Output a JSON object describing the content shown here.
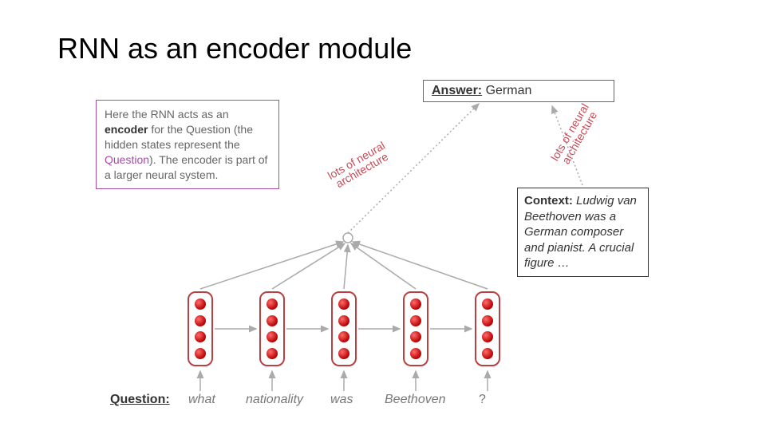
{
  "title": "RNN as an encoder module",
  "description": {
    "line1_prefix": "Here the RNN acts as an ",
    "line1_bold": "encoder",
    "line1_suffix": " for the Question (the hidden states represent the ",
    "line1_purple": "Question",
    "line1_end": "). The encoder is part of a larger neural system."
  },
  "answer": {
    "label": "Answer:",
    "text": "German"
  },
  "context": {
    "label": "Context:",
    "text": "Ludwig van Beethoven was a German composer and pianist. A crucial figure …"
  },
  "question": {
    "label": "Question:",
    "tokens": [
      "what",
      "nationality",
      "was",
      "Beethoven",
      "?"
    ]
  },
  "neural_label": {
    "line1": "lots of neural",
    "line2": "architecture"
  },
  "colors": {
    "cell_border": "#b84040",
    "dot": "#c41e1e",
    "purple": "#a64ca6",
    "red_text": "#c44d58"
  }
}
